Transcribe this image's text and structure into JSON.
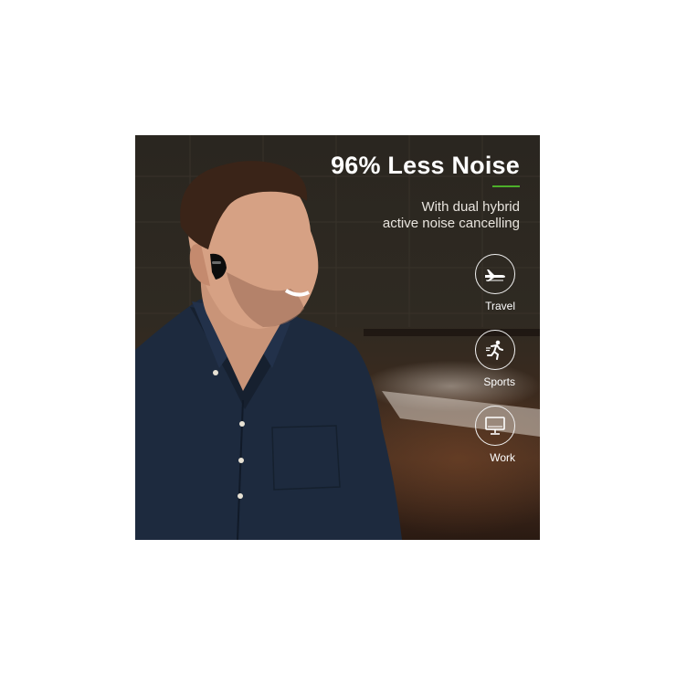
{
  "banner": {
    "headline": "96% Less Noise",
    "subtitle_line1": "With dual hybrid",
    "subtitle_line2": "active noise cancelling",
    "accent_color": "#4caf2a"
  },
  "features": [
    {
      "label": "Travel",
      "icon": "airplane-icon"
    },
    {
      "label": "Sports",
      "icon": "running-person-icon"
    },
    {
      "label": "Work",
      "icon": "monitor-icon"
    }
  ]
}
